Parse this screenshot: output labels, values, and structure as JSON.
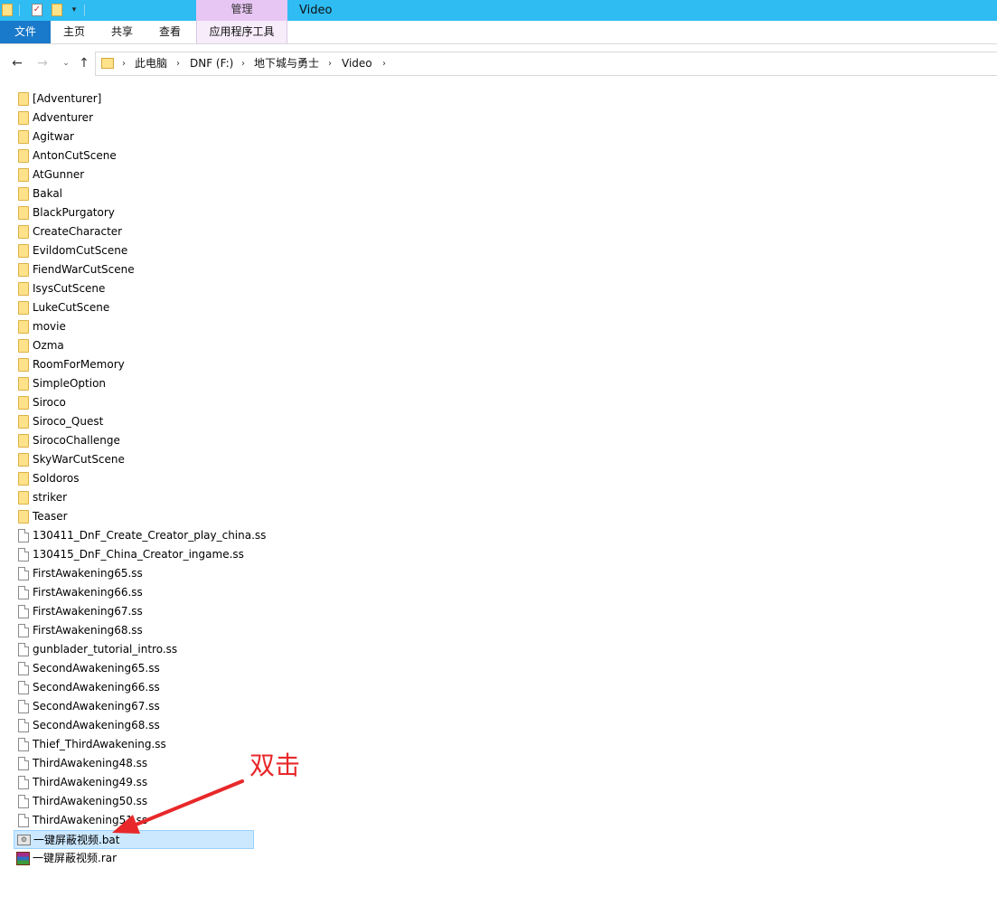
{
  "window": {
    "title": "Video",
    "manage_tab": "管理"
  },
  "quick_access": {
    "check_glyph": "✓",
    "dropdown_glyph": "▾"
  },
  "ribbon": {
    "tabs": [
      "文件",
      "主页",
      "共享",
      "查看",
      "应用程序工具"
    ]
  },
  "nav": {
    "back": "←",
    "forward": "→",
    "recent": "⌄",
    "up": "↑",
    "separator": "›",
    "breadcrumbs": [
      "此电脑",
      "DNF (F:)",
      "地下城与勇士",
      "Video"
    ]
  },
  "files": [
    {
      "name": "[Adventurer]",
      "type": "folder"
    },
    {
      "name": "Adventurer",
      "type": "folder"
    },
    {
      "name": "Agitwar",
      "type": "folder"
    },
    {
      "name": "AntonCutScene",
      "type": "folder"
    },
    {
      "name": "AtGunner",
      "type": "folder"
    },
    {
      "name": "Bakal",
      "type": "folder"
    },
    {
      "name": "BlackPurgatory",
      "type": "folder"
    },
    {
      "name": "CreateCharacter",
      "type": "folder"
    },
    {
      "name": "EvildomCutScene",
      "type": "folder"
    },
    {
      "name": "FiendWarCutScene",
      "type": "folder"
    },
    {
      "name": "IsysCutScene",
      "type": "folder"
    },
    {
      "name": "LukeCutScene",
      "type": "folder"
    },
    {
      "name": "movie",
      "type": "folder"
    },
    {
      "name": "Ozma",
      "type": "folder"
    },
    {
      "name": "RoomForMemory",
      "type": "folder"
    },
    {
      "name": "SimpleOption",
      "type": "folder"
    },
    {
      "name": "Siroco",
      "type": "folder"
    },
    {
      "name": "Siroco_Quest",
      "type": "folder"
    },
    {
      "name": "SirocoChallenge",
      "type": "folder"
    },
    {
      "name": "SkyWarCutScene",
      "type": "folder"
    },
    {
      "name": "Soldoros",
      "type": "folder"
    },
    {
      "name": "striker",
      "type": "folder"
    },
    {
      "name": "Teaser",
      "type": "folder"
    },
    {
      "name": "130411_DnF_Create_Creator_play_china.ss",
      "type": "file"
    },
    {
      "name": "130415_DnF_China_Creator_ingame.ss",
      "type": "file"
    },
    {
      "name": "FirstAwakening65.ss",
      "type": "file"
    },
    {
      "name": "FirstAwakening66.ss",
      "type": "file"
    },
    {
      "name": "FirstAwakening67.ss",
      "type": "file"
    },
    {
      "name": "FirstAwakening68.ss",
      "type": "file"
    },
    {
      "name": "gunblader_tutorial_intro.ss",
      "type": "file"
    },
    {
      "name": "SecondAwakening65.ss",
      "type": "file"
    },
    {
      "name": "SecondAwakening66.ss",
      "type": "file"
    },
    {
      "name": "SecondAwakening67.ss",
      "type": "file"
    },
    {
      "name": "SecondAwakening68.ss",
      "type": "file"
    },
    {
      "name": "Thief_ThirdAwakening.ss",
      "type": "file"
    },
    {
      "name": "ThirdAwakening48.ss",
      "type": "file"
    },
    {
      "name": "ThirdAwakening49.ss",
      "type": "file"
    },
    {
      "name": "ThirdAwakening50.ss",
      "type": "file"
    },
    {
      "name": "ThirdAwakening51.ss",
      "type": "file"
    },
    {
      "name": "一键屏蔽视频.bat",
      "type": "bat",
      "selected": true
    },
    {
      "name": "一键屏蔽视频.rar",
      "type": "rar"
    }
  ],
  "annotation": {
    "text": "双击",
    "color": "#e8282a"
  },
  "colors": {
    "titlebar": "#2fbcf2",
    "file_tab": "#1979ca",
    "manage_tab": "#e7c6f4",
    "selection": "#cce8ff",
    "folder_icon": "#ffe28a"
  }
}
